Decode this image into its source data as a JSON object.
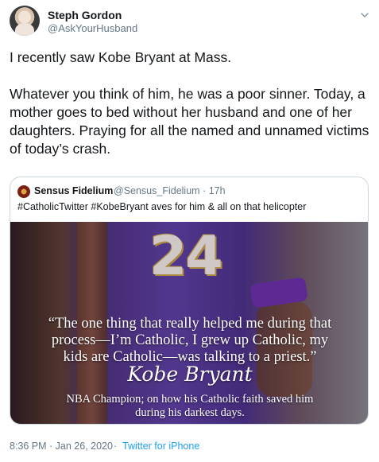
{
  "author": {
    "display_name": "Steph Gordon",
    "handle": "@AskYourHusband"
  },
  "tweet": {
    "text": "I recently saw Kobe Bryant at Mass.\n\nWhatever you think of him, he was a poor sinner. Today, a mother goes to bed without her husband and one of her daughters. Praying for all the named and unnamed victims of today’s crash."
  },
  "quoted_tweet": {
    "display_name": "Sensus Fidelium",
    "handle": "@Sensus_Fidelium",
    "separator": "·",
    "time": "17h",
    "text": "#CatholicTwitter #KobeBryant aves for him & all on that helicopter",
    "image": {
      "jersey_number": "24",
      "quote_lines": [
        "“The one thing that really helped me during that",
        "process—I’m Catholic, I grew up Catholic, my",
        "kids are Catholic—was talking to a priest.”"
      ],
      "signature": "Kobe Bryant",
      "caption_lines": [
        "NBA Champion; on how his Catholic faith saved him",
        "during his darkest days."
      ]
    }
  },
  "footer": {
    "timestamp": "8:36 PM · Jan 26, 2020",
    "separator": "·",
    "source": "Twitter for iPhone"
  },
  "icons": {
    "caret": "chevron-down-icon"
  },
  "colors": {
    "link": "#1da1f2",
    "secondary_text": "#657786",
    "border": "#ccd6dd"
  }
}
